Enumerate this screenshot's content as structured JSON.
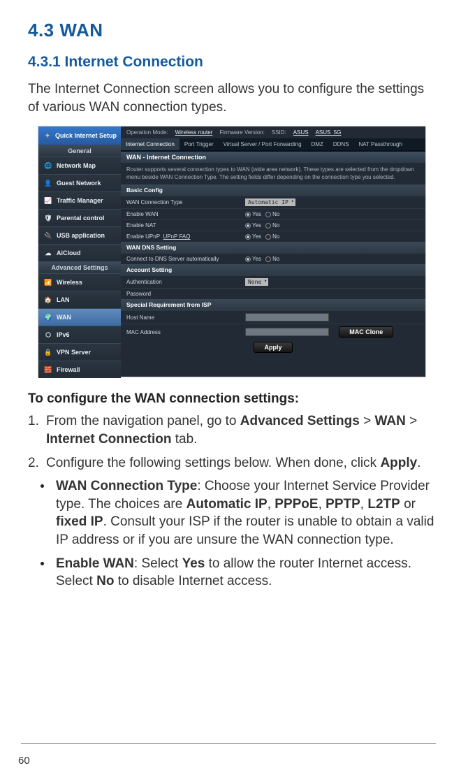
{
  "heading": "4.3   WAN",
  "subheading": "4.3.1 Internet Connection",
  "intro": "The Internet Connection screen allows you to configure the settings of various WAN connection types.",
  "shot": {
    "qis": "Quick Internet Setup",
    "sideGeneral": "General",
    "sideAdvanced": "Advanced Settings",
    "items": {
      "networkMap": "Network Map",
      "guest": "Guest Network",
      "traffic": "Traffic Manager",
      "parental": "Parental control",
      "usb": "USB application",
      "aicloud": "AiCloud",
      "wireless": "Wireless",
      "lan": "LAN",
      "wan": "WAN",
      "ipv6": "IPv6",
      "vpn": "VPN Server",
      "firewall": "Firewall"
    },
    "top": {
      "opModeLbl": "Operation Mode:",
      "opModeVal": "Wireless router",
      "fwLbl": "Firmware Version:",
      "ssidLbl": "SSID:",
      "ssid1": "ASUS",
      "ssid2": "ASUS_5G"
    },
    "tabs": {
      "ic": "Internet Connection",
      "pt": "Port Trigger",
      "vs": "Virtual Server / Port Forwarding",
      "dmz": "DMZ",
      "ddns": "DDNS",
      "nat": "NAT Passthrough"
    },
    "panelTitle": "WAN - Internet Connection",
    "panelDesc": "Router supports several connection types to WAN (wide area network). These types are selected from the dropdown menu beside WAN Connection Type. The setting fields differ depending on the connection type you selected.",
    "bands": {
      "basic": "Basic Config",
      "dns": "WAN DNS Setting",
      "acct": "Account Setting",
      "isp": "Special Requirement from ISP"
    },
    "rows": {
      "wanType": "WAN Connection Type",
      "wanTypeVal": "Automatic IP",
      "enableWan": "Enable WAN",
      "enableNat": "Enable NAT",
      "enableUpnp": "Enable UPnP",
      "upnpFaq": "UPnP  FAQ",
      "dnsAuto": "Connect to DNS Server automatically",
      "auth": "Authentication",
      "authVal": "None",
      "pwd": "Password",
      "host": "Host Name",
      "mac": "MAC Address",
      "yes": "Yes",
      "no": "No",
      "macClone": "MAC Clone",
      "apply": "Apply"
    }
  },
  "stepsTitle": "To configure the WAN connection settings:",
  "steps": {
    "s1a": "From the navigation panel, go to ",
    "s1b": "Advanced Settings",
    "s1c": " > ",
    "s1d": "WAN",
    "s1e": " > ",
    "s1f": "Internet Connection",
    "s1g": " tab.",
    "s2a": "Configure the following settings below. When done, click ",
    "s2b": "Apply",
    "s2c": "."
  },
  "bul": {
    "b1a": "WAN Connection Type",
    "b1b": ": Choose your Internet Service Provider type. The choices are ",
    "b1c": "Automatic IP",
    "b1d": ", ",
    "b1e": "PPPoE",
    "b1f": ", ",
    "b1g": "PPTP",
    "b1h": ", ",
    "b1i": "L2TP",
    "b1j": " or ",
    "b1k": "fixed IP",
    "b1l": ". Consult your ISP if the router is unable to obtain a valid IP address or if you are unsure the WAN connection type.",
    "b2a": "Enable WAN",
    "b2b": ": Select ",
    "b2c": "Yes",
    "b2d": " to allow the router Internet access. Select ",
    "b2e": "No",
    "b2f": " to disable Internet access."
  },
  "pageNum": "60"
}
